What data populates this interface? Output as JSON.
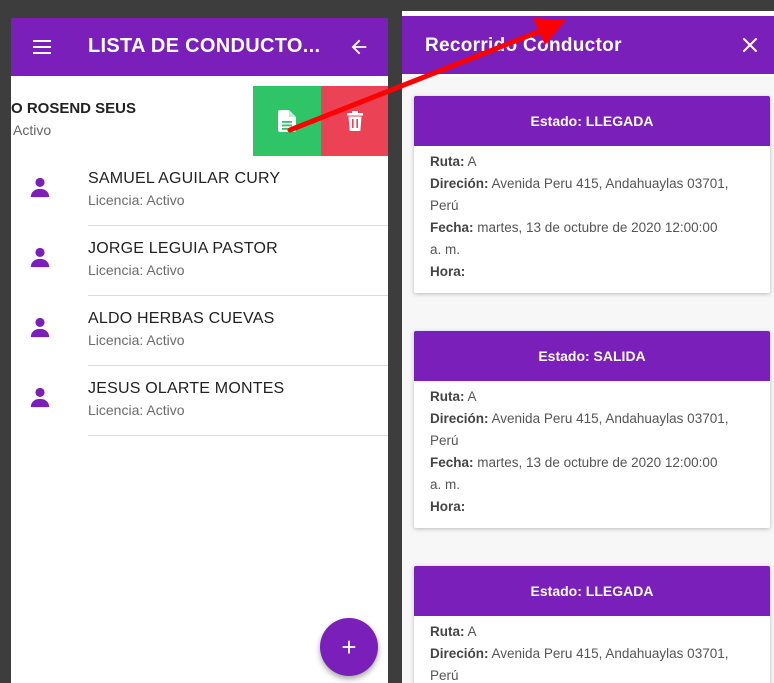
{
  "left": {
    "title": "LISTA DE CONDUCTO...",
    "swiped": {
      "name": "O ROSEND SEUS",
      "status": "Activo"
    },
    "drivers": [
      {
        "name": "SAMUEL  AGUILAR CURY",
        "license": "Licencia:  Activo"
      },
      {
        "name": "JORGE  LEGUIA PASTOR",
        "license": "Licencia:  Activo"
      },
      {
        "name": "ALDO  HERBAS CUEVAS",
        "license": "Licencia:  Activo"
      },
      {
        "name": "JESUS  OLARTE MONTES",
        "license": "Licencia:  Activo"
      }
    ],
    "fab_label": "+"
  },
  "right": {
    "title": "Recorrido Conductor",
    "labels": {
      "ruta": "Ruta:",
      "direccion": "Direción:",
      "fecha": "Fecha:",
      "hora": "Hora:"
    },
    "cards": [
      {
        "estado": "Estado: LLEGADA",
        "ruta": "A",
        "direccion_1": "Avenida Peru 415, Andahuaylas 03701,",
        "direccion_2": "Perú",
        "fecha_1": "martes, 13 de octubre de 2020 12:00:00",
        "fecha_2": "a. m.",
        "hora": ""
      },
      {
        "estado": "Estado: SALIDA",
        "ruta": "A",
        "direccion_1": "Avenida Peru 415, Andahuaylas 03701,",
        "direccion_2": "Perú",
        "fecha_1": "martes, 13 de octubre de 2020 12:00:00",
        "fecha_2": "a. m.",
        "hora": ""
      },
      {
        "estado": "Estado: LLEGADA",
        "ruta": "A",
        "direccion_1": "Avenida Peru 415, Andahuaylas 03701,",
        "direccion_2": "Perú"
      }
    ]
  },
  "colors": {
    "primary": "#7b1fba",
    "swipe_green": "#2fc467",
    "swipe_red": "#ec4255",
    "arrow_red": "#ff0000"
  },
  "icons": [
    "menu-icon",
    "back-arrow-icon",
    "document-icon",
    "trash-icon",
    "person-icon",
    "close-icon",
    "add-icon"
  ]
}
